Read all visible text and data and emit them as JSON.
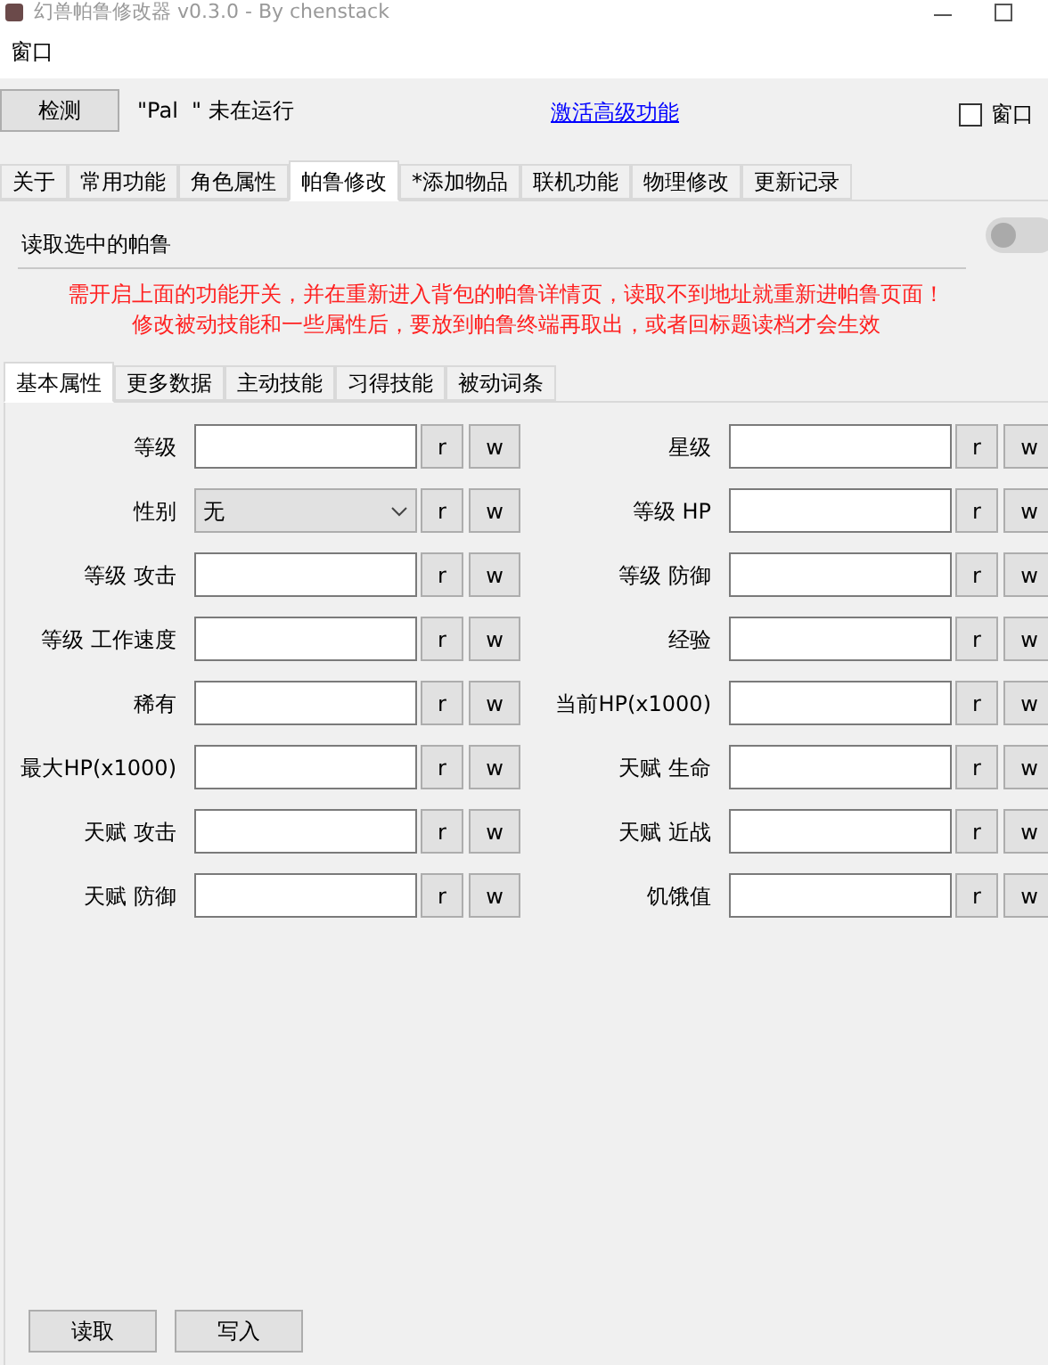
{
  "window": {
    "title": "幻兽帕鲁修改器 v0.3.0 - By chenstack"
  },
  "menu": [
    "窗口"
  ],
  "toolbar": {
    "detect_button": "检测",
    "status": "\"Pal  \" 未在运行",
    "link": "激活高级功能",
    "topmost": {
      "label": "窗口",
      "checked": false
    }
  },
  "tabs": [
    {
      "label": "关于",
      "selected": false
    },
    {
      "label": "常用功能",
      "selected": false
    },
    {
      "label": "角色属性",
      "selected": false
    },
    {
      "label": "帕鲁修改",
      "selected": true
    },
    {
      "label": "*添加物品",
      "selected": false
    },
    {
      "label": "联机功能",
      "selected": false
    },
    {
      "label": "物理修改",
      "selected": false
    },
    {
      "label": "更新记录",
      "selected": false
    }
  ],
  "read_selected": {
    "label": "读取选中的帕鲁",
    "on": false
  },
  "notice": [
    "需开启上面的功能开关，并在重新进入背包的帕鲁详情页，读取不到地址就重新进帕鲁页面！",
    "修改被动技能和一些属性后，要放到帕鲁终端再取出，或者回标题读档才会生效"
  ],
  "subtabs": [
    {
      "label": "基本属性",
      "selected": true
    },
    {
      "label": "更多数据",
      "selected": false
    },
    {
      "label": "主动技能",
      "selected": false
    },
    {
      "label": "习得技能",
      "selected": false
    },
    {
      "label": "被动词条",
      "selected": false
    }
  ],
  "fields": [
    {
      "label": "等级",
      "kind": "text",
      "read": "r",
      "write": "w"
    },
    {
      "label": "星级",
      "kind": "text",
      "read": "r",
      "write": "w"
    },
    {
      "label": "性别",
      "kind": "select",
      "value": "无",
      "read": "r",
      "write": "w"
    },
    {
      "label": "等级 HP",
      "kind": "text",
      "read": "r",
      "write": "w"
    },
    {
      "label": "等级 攻击",
      "kind": "text",
      "read": "r",
      "write": "w"
    },
    {
      "label": "等级 防御",
      "kind": "text",
      "read": "r",
      "write": "w"
    },
    {
      "label": "等级 工作速度",
      "kind": "text",
      "read": "r",
      "write": "w"
    },
    {
      "label": "经验",
      "kind": "text",
      "read": "r",
      "write": "w"
    },
    {
      "label": "稀有",
      "kind": "text",
      "read": "r",
      "write": "w"
    },
    {
      "label": "当前HP(x1000)",
      "kind": "text",
      "read": "r",
      "write": "w"
    },
    {
      "label": "最大HP(x1000)",
      "kind": "text",
      "read": "r",
      "write": "w"
    },
    {
      "label": "天赋 生命",
      "kind": "text",
      "read": "r",
      "write": "w"
    },
    {
      "label": "天赋 攻击",
      "kind": "text",
      "read": "r",
      "write": "w"
    },
    {
      "label": "天赋 近战",
      "kind": "text",
      "read": "r",
      "write": "w"
    },
    {
      "label": "天赋 防御",
      "kind": "text",
      "read": "r",
      "write": "w"
    },
    {
      "label": "饥饿值",
      "kind": "text",
      "read": "r",
      "write": "w"
    }
  ],
  "buttons": [
    "读取",
    "写入"
  ]
}
